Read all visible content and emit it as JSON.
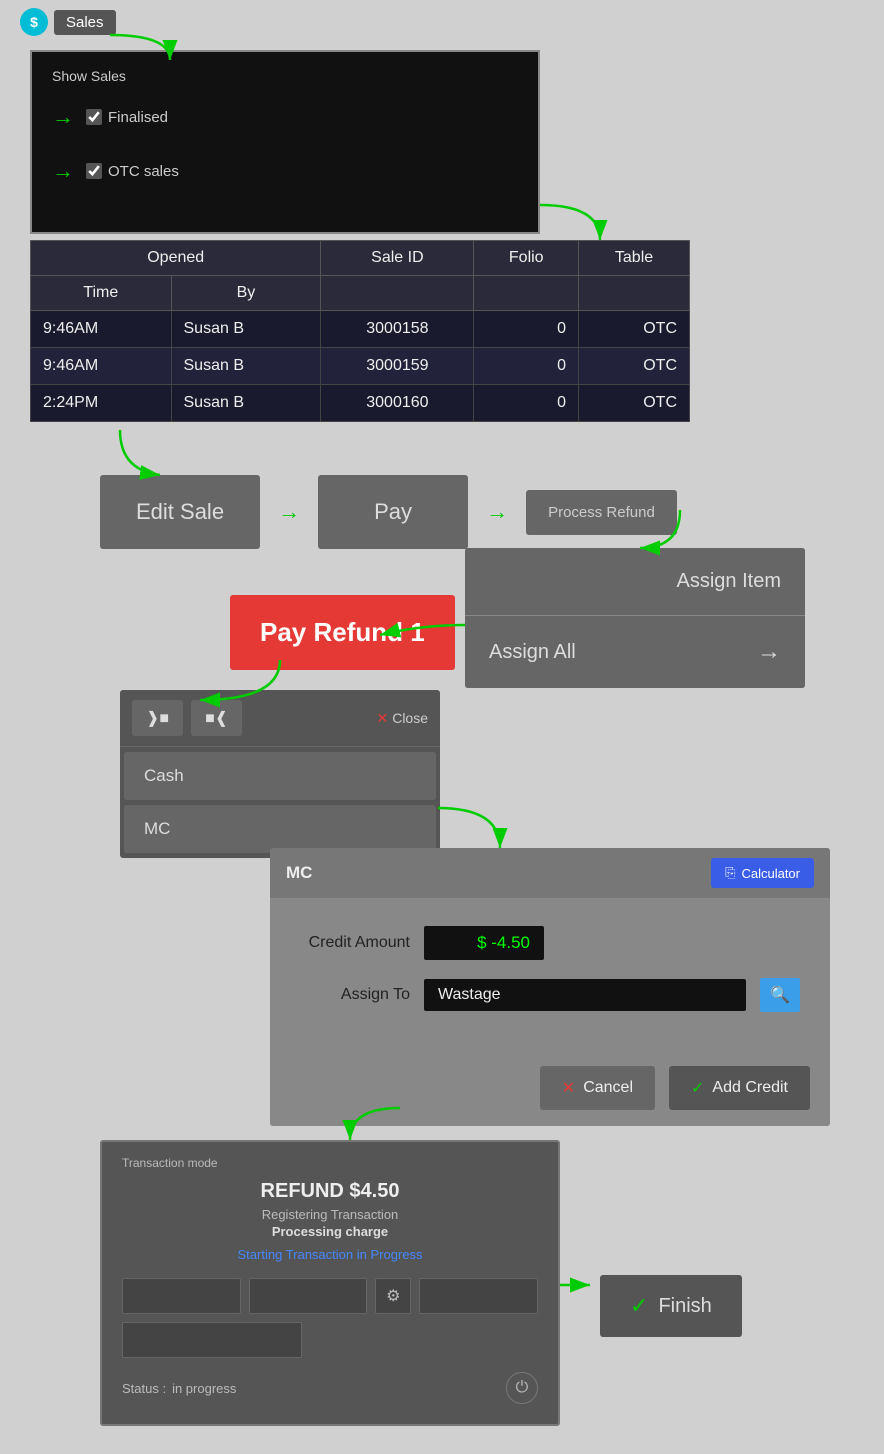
{
  "app": {
    "title": "Sales"
  },
  "showSales": {
    "title": "Show Sales",
    "options": [
      {
        "label": "Finalised",
        "checked": true
      },
      {
        "label": "OTC sales",
        "checked": true
      }
    ]
  },
  "table": {
    "headers": {
      "opened": "Opened",
      "time": "Time",
      "by": "By",
      "saleId": "Sale ID",
      "folio": "Folio",
      "tableCol": "Table"
    },
    "rows": [
      {
        "time": "9:46AM",
        "by": "Susan B",
        "saleId": "3000158",
        "folio": "0",
        "table": "OTC"
      },
      {
        "time": "9:46AM",
        "by": "Susan B",
        "saleId": "3000159",
        "folio": "0",
        "table": "OTC"
      },
      {
        "time": "2:24PM",
        "by": "Susan B",
        "saleId": "3000160",
        "folio": "0",
        "table": "OTC"
      }
    ]
  },
  "buttons": {
    "editSale": "Edit Sale",
    "pay": "Pay",
    "processRefund": "Process Refund",
    "assignItem": "Assign Item",
    "assignAll": "Assign All",
    "payRefund": "Pay Refund 1",
    "cash": "Cash",
    "mc": "MC",
    "close": "Close",
    "cancel": "Cancel",
    "addCredit": "Add Credit",
    "finish": "Finish",
    "calculator": "Calculator"
  },
  "mcDialog": {
    "title": "MC",
    "creditAmountLabel": "Credit Amount",
    "creditAmountValue": "$ -4.50",
    "assignToLabel": "Assign To",
    "assignToValue": "Wastage"
  },
  "transaction": {
    "modeLabel": "Transaction mode",
    "refundTitle": "REFUND $4.50",
    "registeringLabel": "Registering Transaction",
    "processingLabel": "Processing charge",
    "progressLabel": "Starting Transaction in Progress",
    "statusLabel": "Status :",
    "statusValue": "in progress"
  },
  "icons": {
    "dollarSign": "$",
    "checkmark": "✓",
    "cross": "✕",
    "search": "🔍",
    "calculator": "⊞",
    "leftPanel": "◫",
    "rightPanel": "⊞",
    "power": "⏻",
    "arrowRight": "→"
  }
}
